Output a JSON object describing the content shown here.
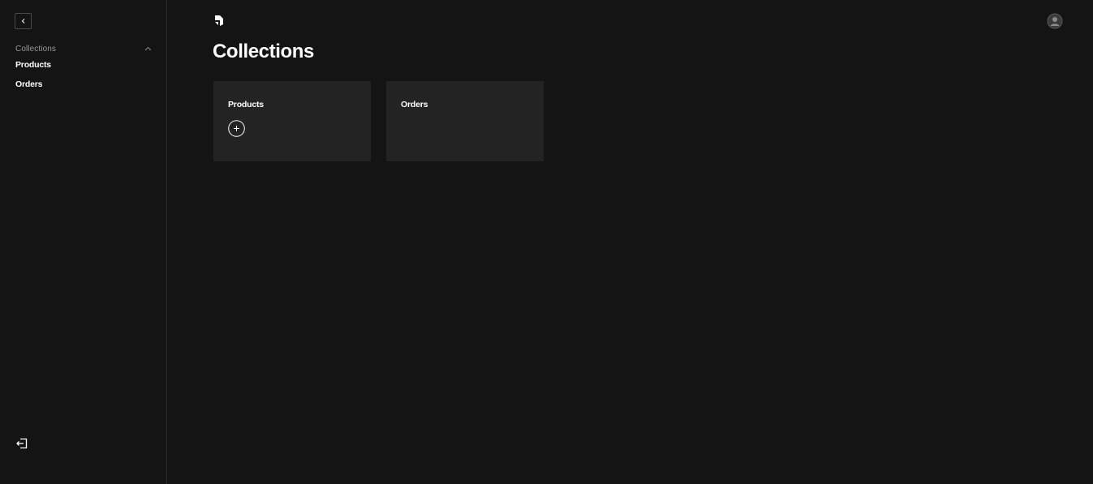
{
  "sidebar": {
    "collapse_icon": "chevron-left-icon",
    "group": {
      "label": "Collections",
      "toggle_icon": "chevron-up-icon",
      "items": [
        {
          "label": "Products"
        },
        {
          "label": "Orders"
        }
      ]
    },
    "logout_icon": "logout-icon"
  },
  "header": {
    "logo_icon": "logo-icon",
    "avatar_icon": "user-avatar-icon"
  },
  "main": {
    "title": "Collections",
    "cards": [
      {
        "title": "Products",
        "has_add_button": true,
        "add_icon": "plus-circle-icon"
      },
      {
        "title": "Orders",
        "has_add_button": false
      }
    ]
  },
  "colors": {
    "background": "#141414",
    "card": "#232323",
    "border": "#2b2b2b",
    "muted_text": "#9a9a9a",
    "text": "#ffffff"
  }
}
